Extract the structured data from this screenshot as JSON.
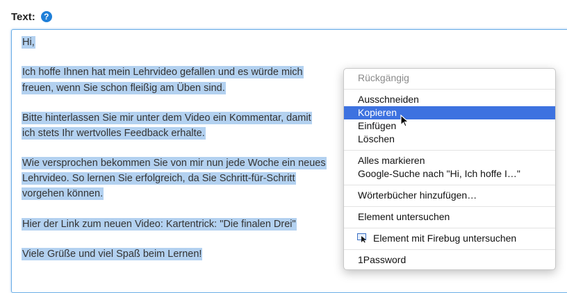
{
  "field": {
    "label": "Text:",
    "help_icon": "?"
  },
  "textarea": {
    "lines": [
      "Hi,",
      "Ich hoffe Ihnen hat mein Lehrvideo gefallen und es würde mich",
      "freuen, wenn Sie schon fleißig am Üben sind.",
      "Bitte hinterlassen Sie mir unter dem Video ein Kommentar, damit",
      "ich stets Ihr wertvolles Feedback erhalte.",
      "Wie versprochen bekommen Sie von mir nun jede Woche ein neues",
      "Lehrvideo. So lernen Sie erfolgreich, da Sie Schritt-für-Schritt",
      "vorgehen können.",
      "Hier der Link zum neuen Video: Kartentrick: \"Die finalen Drei\"",
      "Viele Grüße und viel Spaß beim Lernen!"
    ]
  },
  "context_menu": {
    "undo": "Rückgängig",
    "cut": "Ausschneiden",
    "copy": "Kopieren",
    "paste": "Einfügen",
    "delete": "Löschen",
    "select_all": "Alles markieren",
    "google_search": "Google-Suche nach \"Hi, Ich hoffe I…\"",
    "add_dictionaries": "Wörterbücher hinzufügen…",
    "inspect": "Element untersuchen",
    "firebug_inspect": "Element mit Firebug untersuchen",
    "onepassword": "1Password"
  },
  "colors": {
    "selection": "#b3d1f0",
    "menu_highlight": "#3d72e0",
    "focus_border": "#6aaee6",
    "help_icon": "#1f7fd8"
  }
}
